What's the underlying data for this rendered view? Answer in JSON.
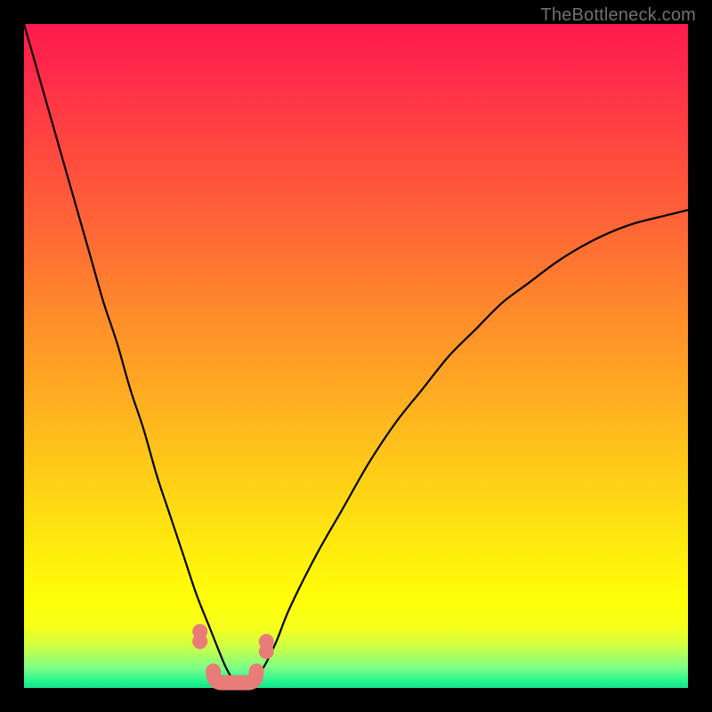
{
  "watermark": "TheBottleneck.com",
  "chart_data": {
    "type": "line",
    "title": "",
    "xlabel": "",
    "ylabel": "",
    "xlim": [
      0,
      100
    ],
    "ylim": [
      0,
      100
    ],
    "background_gradient": {
      "top_color": "#ff1a4f",
      "mid_color": "#ffee0d",
      "bottom_color": "#17e28a"
    },
    "series": [
      {
        "name": "bottleneck-curve",
        "color": "#000000",
        "x": [
          0,
          2,
          4,
          6,
          8,
          10,
          12,
          14,
          16,
          18,
          20,
          22,
          24,
          26,
          28,
          30,
          31,
          32,
          34,
          36,
          38,
          40,
          44,
          48,
          52,
          56,
          60,
          64,
          68,
          72,
          76,
          80,
          84,
          88,
          92,
          96,
          100
        ],
        "y": [
          100,
          93,
          86,
          79,
          72,
          65,
          58,
          52,
          45,
          39,
          32,
          26,
          20,
          14,
          9,
          4,
          2,
          1,
          1,
          3,
          7,
          12,
          20,
          27,
          34,
          40,
          45,
          50,
          54,
          58,
          61,
          64,
          66.5,
          68.5,
          70,
          71,
          72
        ]
      }
    ],
    "markers": {
      "color": "#e87c78",
      "cluster_left": {
        "x": 26.5,
        "y_top": 8.5,
        "y_bottom": 7.0
      },
      "bottom_segment": {
        "x_start": 28.5,
        "x_end": 35.0,
        "y": 1.2
      },
      "cluster_right": {
        "x": 36.5,
        "y_top": 7.0,
        "y_bottom": 5.5
      }
    }
  }
}
